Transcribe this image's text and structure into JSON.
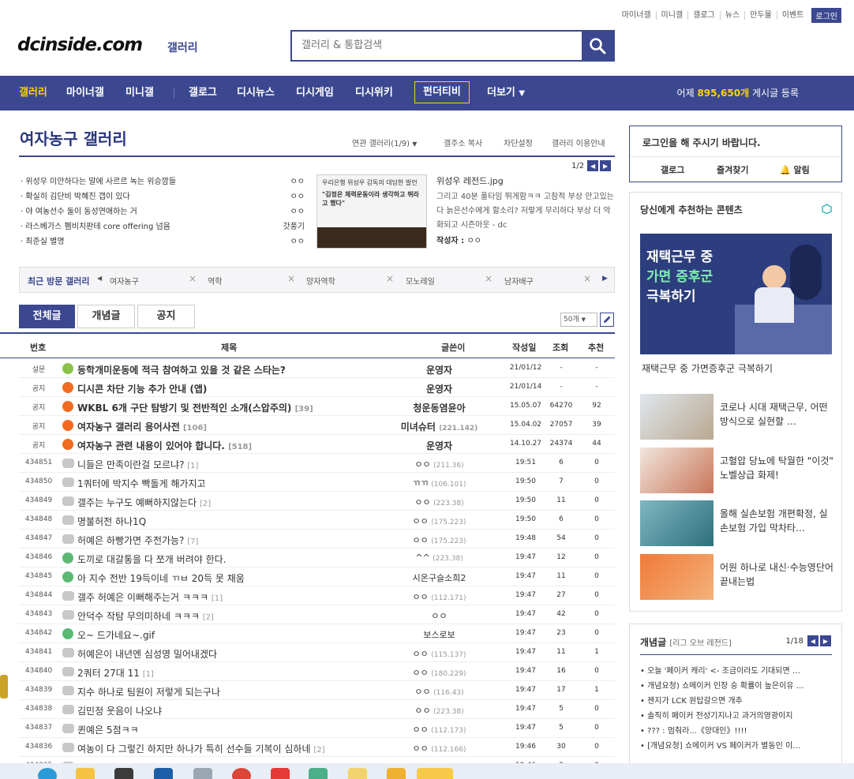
{
  "top_links": {
    "items": [
      "마이너갤",
      "미니갤",
      "갤로그",
      "뉴스",
      "만두몰",
      "이벤트"
    ],
    "login": "로그인"
  },
  "logo": {
    "text": "dcinside.com",
    "sub": "갤러리"
  },
  "search": {
    "placeholder": "갤러리 & 통합검색"
  },
  "nav": {
    "items": [
      "갤러리",
      "마이너갤",
      "미니갤",
      "갤로그",
      "디시뉴스",
      "디시게임",
      "디시위키",
      "펀더티비",
      "더보기"
    ],
    "stats_prefix": "어제",
    "stats_count": "895,650개",
    "stats_suffix": "게시글 등록"
  },
  "gallery": {
    "title": "여자농구 갤러리",
    "tools": [
      "연관 갤러리(1/9)",
      "갤주소 복사",
      "차단설정",
      "갤러리 이용안내"
    ],
    "page_indicator": "1/2"
  },
  "issues": [
    {
      "title": "위성우 미안하다는 말에 사르르 녹는 위승깜들",
      "author": "ㅇㅇ"
    },
    {
      "title": "확실히 김단비 박혜진 갭이 있다",
      "author": "ㅇㅇ"
    },
    {
      "title": "야 여농선수 둘이 동성연애하는 거",
      "author": "ㅇㅇ"
    },
    {
      "title": "라스베가스 펨비치판테 core offering 넘음",
      "author": "갓풍기"
    },
    {
      "title": "최준실 별명",
      "author": "ㅇㅇ"
    }
  ],
  "feature": {
    "img_line1": "우리은행 위성우 감독의 대담한 발언",
    "img_line2": "\"김정은 체력운동이라 생각하고 뛰라고 했다\"",
    "title": "위성우 레전드.jpg",
    "body": "그리고 40분 풀타임 뛰게함ㅋㅋ 고참적 부상 안고있는 다 늙은선수에게 할소리? 저렇게 무리하다 부상 더 악화되고 시즌아웃 - dc",
    "author_label": "작성자 :",
    "author": "ㅇㅇ"
  },
  "recent": {
    "title": "최근 방문 갤러리",
    "items": [
      "여자농구",
      "역학",
      "양자역학",
      "모노레일",
      "남자배구"
    ]
  },
  "tabs": [
    "전체글",
    "개념글",
    "공지"
  ],
  "page_size": "50개",
  "table_header": {
    "num": "번호",
    "title": "제목",
    "writer": "글쓴이",
    "date": "작성일",
    "views": "조회",
    "rec": "추천"
  },
  "posts": [
    {
      "num": "설문",
      "icon": "speak",
      "title": "동학개미운동에 적극 참여하고 있을 것 같은 스타는?",
      "reply": "",
      "writer": "운영자",
      "ip": "",
      "date": "21/01/12",
      "views": "-",
      "rec": "-",
      "notice": true
    },
    {
      "num": "공지",
      "icon": "notice",
      "title": "디시콘 차단 기능 추가 안내 (앱)",
      "reply": "",
      "writer": "운영자",
      "ip": "",
      "date": "21/01/14",
      "views": "-",
      "rec": "-",
      "notice": true
    },
    {
      "num": "공지",
      "icon": "notice",
      "title": "WKBL 6개 구단 탐방기 및 전반적인 소개(스압주의)",
      "reply": "[39]",
      "writer": "청운동염윤아",
      "ip": "",
      "date": "15.05.07",
      "views": "64270",
      "rec": "92",
      "notice": true
    },
    {
      "num": "공지",
      "icon": "notice",
      "title": "여자농구 갤러리 용어사전",
      "reply": "[106]",
      "writer": "미녀슈터",
      "ip": "(221.142)",
      "date": "15.04.02",
      "views": "27057",
      "rec": "39",
      "notice": true
    },
    {
      "num": "공지",
      "icon": "notice",
      "title": "여자농구 관련 내용이 있어야 합니다.",
      "reply": "[518]",
      "writer": "운영자",
      "ip": "",
      "date": "14.10.27",
      "views": "24374",
      "rec": "44",
      "notice": true
    },
    {
      "num": "434851",
      "icon": "txt",
      "title": "니들은 만족이란걸 모르냐?",
      "reply": "[1]",
      "writer": "ㅇㅇ",
      "ip": "(211.36)",
      "date": "19:51",
      "views": "6",
      "rec": "0",
      "notice": false
    },
    {
      "num": "434850",
      "icon": "txt",
      "title": "1쿼터에 박지수 빡돌게 해가지고",
      "reply": "",
      "writer": "ㄲㄲ",
      "ip": "(106.101)",
      "date": "19:50",
      "views": "7",
      "rec": "0",
      "notice": false
    },
    {
      "num": "434849",
      "icon": "txt",
      "title": "갤주는 누구도 예뻐하지않는다",
      "reply": "[2]",
      "writer": "ㅇㅇ",
      "ip": "(223.38)",
      "date": "19:50",
      "views": "11",
      "rec": "0",
      "notice": false
    },
    {
      "num": "434848",
      "icon": "txt",
      "title": "명불허전 하나1Q",
      "reply": "",
      "writer": "ㅇㅇ",
      "ip": "(175.223)",
      "date": "19:50",
      "views": "6",
      "rec": "0",
      "notice": false
    },
    {
      "num": "434847",
      "icon": "txt",
      "title": "허예은 하빵가면 주전가능?",
      "reply": "[7]",
      "writer": "ㅇㅇ",
      "ip": "(175.223)",
      "date": "19:48",
      "views": "54",
      "rec": "0",
      "notice": false
    },
    {
      "num": "434846",
      "icon": "img",
      "title": "도끼로 대갈통을 다 쪼개 버려야 한다.",
      "reply": "",
      "writer": "^^",
      "ip": "(223.38)",
      "date": "19:47",
      "views": "12",
      "rec": "0",
      "notice": false
    },
    {
      "num": "434845",
      "icon": "img",
      "title": "아 지수 전반 19득이네 ㄲㅂ 20득 못 채움",
      "reply": "",
      "writer": "시온구슬소희2",
      "ip": "",
      "date": "19:47",
      "views": "11",
      "rec": "0",
      "notice": false
    },
    {
      "num": "434844",
      "icon": "txt",
      "title": "갤주 허예은 이뻐해주는거 ㅋㅋㅋ",
      "reply": "[1]",
      "writer": "ㅇㅇ",
      "ip": "(112.171)",
      "date": "19:47",
      "views": "27",
      "rec": "0",
      "notice": false
    },
    {
      "num": "434843",
      "icon": "txt",
      "title": "안덕수 작탐 무의미하네 ㅋㅋㅋ",
      "reply": "[2]",
      "writer": "ㅇㅇ",
      "ip": "",
      "date": "19:47",
      "views": "42",
      "rec": "0",
      "notice": false
    },
    {
      "num": "434842",
      "icon": "img",
      "title": "오~ 드가네요~.gif",
      "reply": "",
      "writer": "보스로보",
      "ip": "",
      "date": "19:47",
      "views": "23",
      "rec": "0",
      "notice": false
    },
    {
      "num": "434841",
      "icon": "txt",
      "title": "허예은이 내년엔 심성영 밀어내겠다",
      "reply": "",
      "writer": "ㅇㅇ",
      "ip": "(115.137)",
      "date": "19:47",
      "views": "11",
      "rec": "1",
      "notice": false
    },
    {
      "num": "434840",
      "icon": "txt",
      "title": "2쿼터 27대 11",
      "reply": "[1]",
      "writer": "ㅇㅇ",
      "ip": "(180.229)",
      "date": "19:47",
      "views": "16",
      "rec": "0",
      "notice": false
    },
    {
      "num": "434839",
      "icon": "txt",
      "title": "지수 하나로 팀원이 저렇게 되는구나",
      "reply": "",
      "writer": "ㅇㅇ",
      "ip": "(116.43)",
      "date": "19:47",
      "views": "17",
      "rec": "1",
      "notice": false
    },
    {
      "num": "434838",
      "icon": "txt",
      "title": "김민정 웃음이 나오냐",
      "reply": "",
      "writer": "ㅇㅇ",
      "ip": "(223.38)",
      "date": "19:47",
      "views": "5",
      "rec": "0",
      "notice": false
    },
    {
      "num": "434837",
      "icon": "txt",
      "title": "퀸예은 5점ㅋㅋ",
      "reply": "",
      "writer": "ㅇㅇ",
      "ip": "(112.173)",
      "date": "19:47",
      "views": "5",
      "rec": "0",
      "notice": false
    },
    {
      "num": "434836",
      "icon": "txt",
      "title": "여농이 다 그렇긴 하지만 하나가 특히 선수들 기복이 심하네",
      "reply": "[2]",
      "writer": "ㅇㅇ",
      "ip": "(112.166)",
      "date": "19:46",
      "views": "30",
      "rec": "0",
      "notice": false
    },
    {
      "num": "434835",
      "icon": "txt",
      "title": "허예은 ㅋㅋㅋㅋ",
      "reply": "",
      "writer": "ㅇㅇ",
      "ip": "(180.229)",
      "date": "19:46",
      "views": "3",
      "rec": "0",
      "notice": false
    }
  ],
  "login_box": {
    "msg": "로그인을 해 주시기 바랍니다.",
    "links": [
      "갤로그",
      "즐겨찾기",
      "알림"
    ]
  },
  "recommend": {
    "title": "당신에게 추천하는 콘텐츠",
    "big_ad_lines": [
      "재택근무 중",
      "가면 증후군",
      "극복하기"
    ],
    "big_caption": "재택근무 중 가면증후군 극복하기",
    "items": [
      {
        "text": "코로나 시대 재택근무, 어떤 방식으로 실현할 …"
      },
      {
        "text": "고혈압 당뇨에 탁월한 \"이것\" 노벨상급 화제!"
      },
      {
        "text": "올해 실손보험 개편확정, 실손보험 가입 막차타…"
      },
      {
        "text": "어원 하나로 내신·수능영단어 끝내는법"
      }
    ]
  },
  "concept": {
    "title": "개념글",
    "subtitle": "[리그 오브 레전드]",
    "page": "1/18",
    "items": [
      "오늘 '페이커 캐리' <- 조금이라도 기대되면 …",
      "개념요청) 쇼메이커 인장 숭 확률이 높은이유 …",
      "젠지가 LCK 원탑갈으면 개추",
      "솔직히 페이커 전성기지나고 과거의영광이지",
      "??? : 멈춰라...《양대인》!!!!",
      "[개념요청] 쇼메이커 VS 페이커가 별동인 이…"
    ]
  },
  "colors": {
    "brand": "#3b4890",
    "accent": "#ffd200",
    "notice": "#f26b21"
  }
}
